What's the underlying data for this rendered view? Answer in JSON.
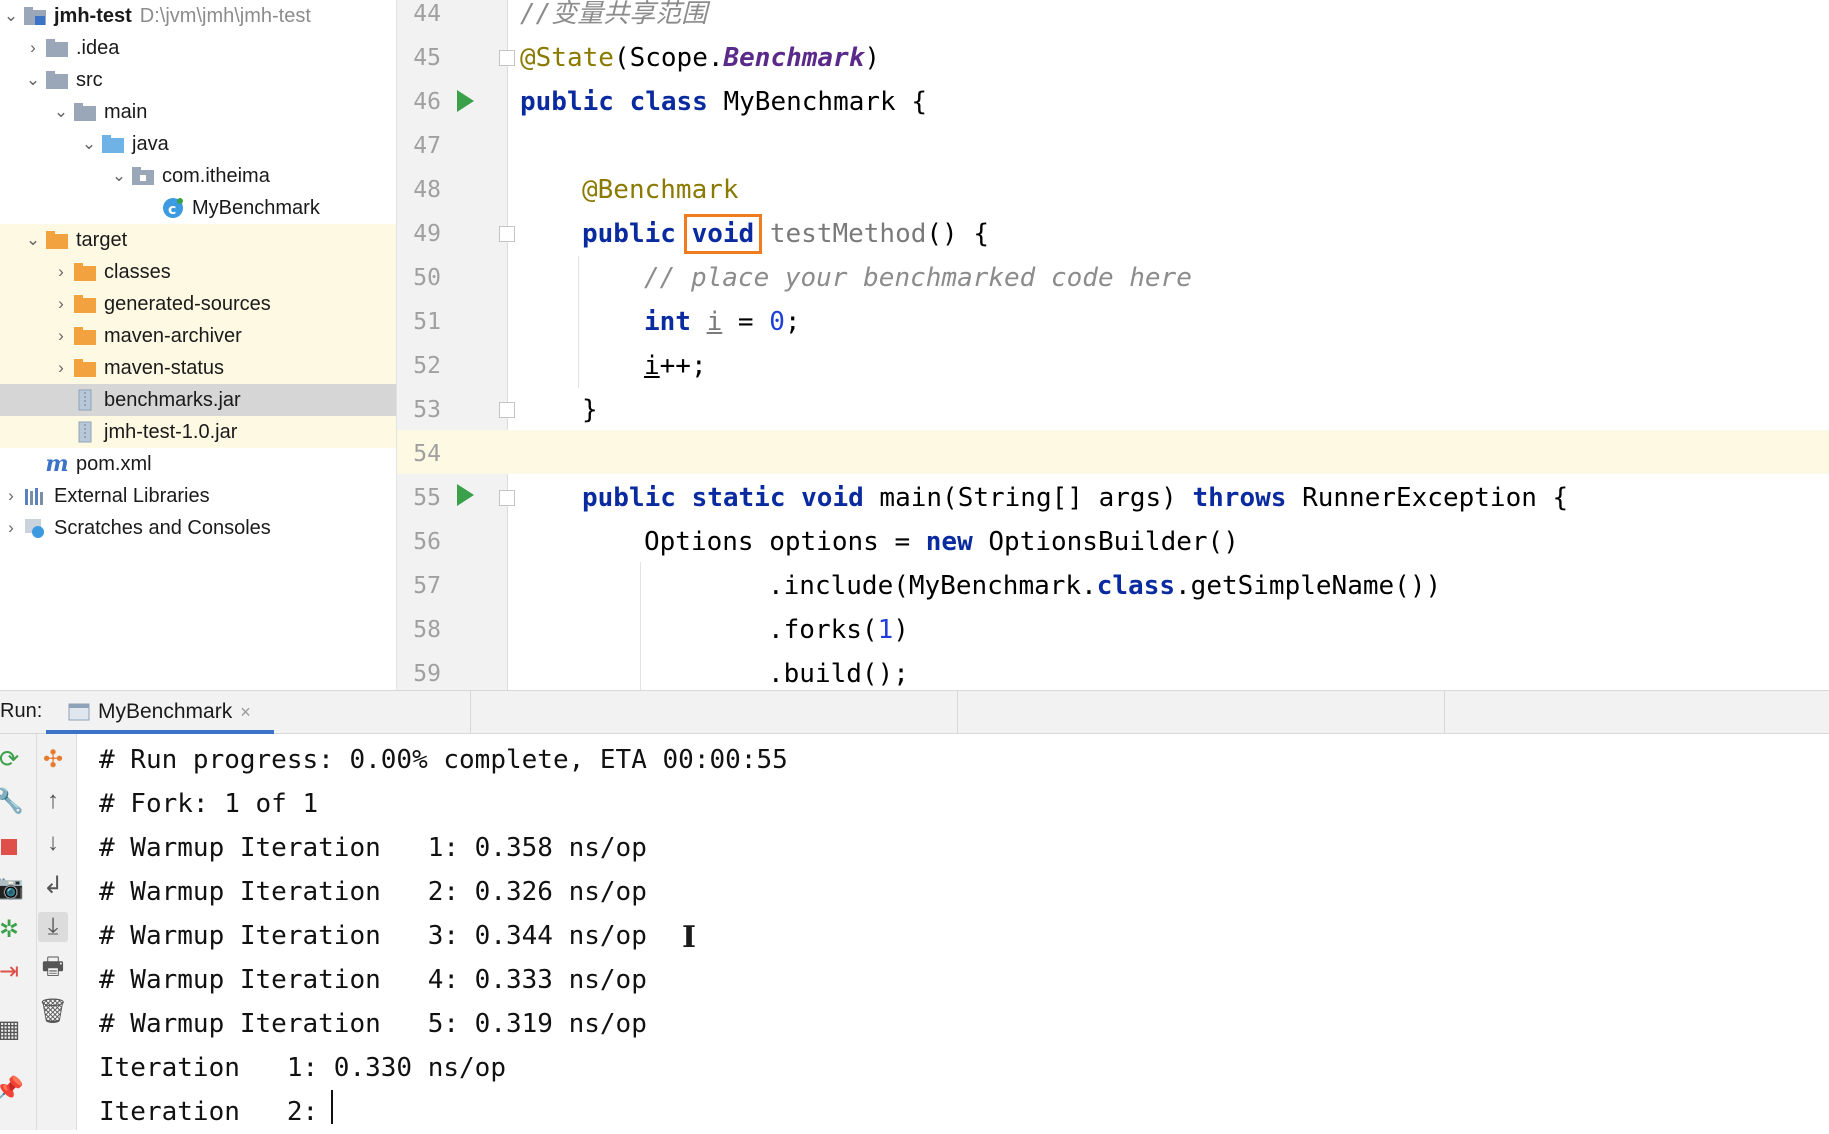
{
  "project_tree": {
    "root": {
      "name": "jmh-test",
      "path": "D:\\jvm\\jmh\\jmh-test"
    },
    "items": [
      {
        "label": ".idea"
      },
      {
        "label": "src"
      },
      {
        "label": "main"
      },
      {
        "label": "java"
      },
      {
        "label": "com.itheima"
      },
      {
        "label": "MyBenchmark"
      },
      {
        "label": "target"
      },
      {
        "label": "classes"
      },
      {
        "label": "generated-sources"
      },
      {
        "label": "maven-archiver"
      },
      {
        "label": "maven-status"
      },
      {
        "label": "benchmarks.jar"
      },
      {
        "label": "jmh-test-1.0.jar"
      },
      {
        "label": "pom.xml"
      },
      {
        "label": "External Libraries"
      },
      {
        "label": "Scratches and Consoles"
      }
    ]
  },
  "editor": {
    "line_numbers": [
      "44",
      "45",
      "46",
      "47",
      "48",
      "49",
      "50",
      "51",
      "52",
      "53",
      "54",
      "55",
      "56",
      "57",
      "58",
      "59"
    ],
    "code": {
      "l44_comment": "//变量共享范围",
      "l45_anno": "@State",
      "l45_p1": "(Scope.",
      "l45_it": "Benchmark",
      "l45_p2": ")",
      "l46_kw": "public class ",
      "l46_name": "MyBenchmark",
      "l46_rest": " {",
      "l48_anno": "@Benchmark",
      "l49_kw1": "public ",
      "l49_kw2": "void",
      "l49_method": " testMethod",
      "l49_rest": "() {",
      "l50_comment": "// place your benchmarked code here",
      "l51_kw": "int ",
      "l51_var": "i",
      "l51_eq": " = ",
      "l51_num": "0",
      "l51_semi": ";",
      "l52_var": "i",
      "l52_rest": "++;",
      "l53": "}",
      "l55_kw": "public static void ",
      "l55_mid": "main(String[] args) ",
      "l55_throws": "throws",
      "l55_rest": " RunnerException {",
      "l56_a": "Options options = ",
      "l56_new": "new",
      "l56_b": " OptionsBuilder()",
      "l57_a": ".include(MyBenchmark.",
      "l57_class": "class",
      "l57_b": ".getSimpleName())",
      "l58_a": ".forks(",
      "l58_num": "1",
      "l58_b": ")",
      "l59": ".build();"
    }
  },
  "run_panel": {
    "label": "Run:",
    "tab_label": "MyBenchmark",
    "output": [
      "# Run progress: 0.00% complete, ETA 00:00:55",
      "# Fork: 1 of 1",
      "# Warmup Iteration   1: 0.358 ns/op",
      "# Warmup Iteration   2: 0.326 ns/op",
      "# Warmup Iteration   3: 0.344 ns/op",
      "# Warmup Iteration   4: 0.333 ns/op",
      "# Warmup Iteration   5: 0.319 ns/op",
      "Iteration   1: 0.330 ns/op",
      "Iteration   2: "
    ]
  }
}
